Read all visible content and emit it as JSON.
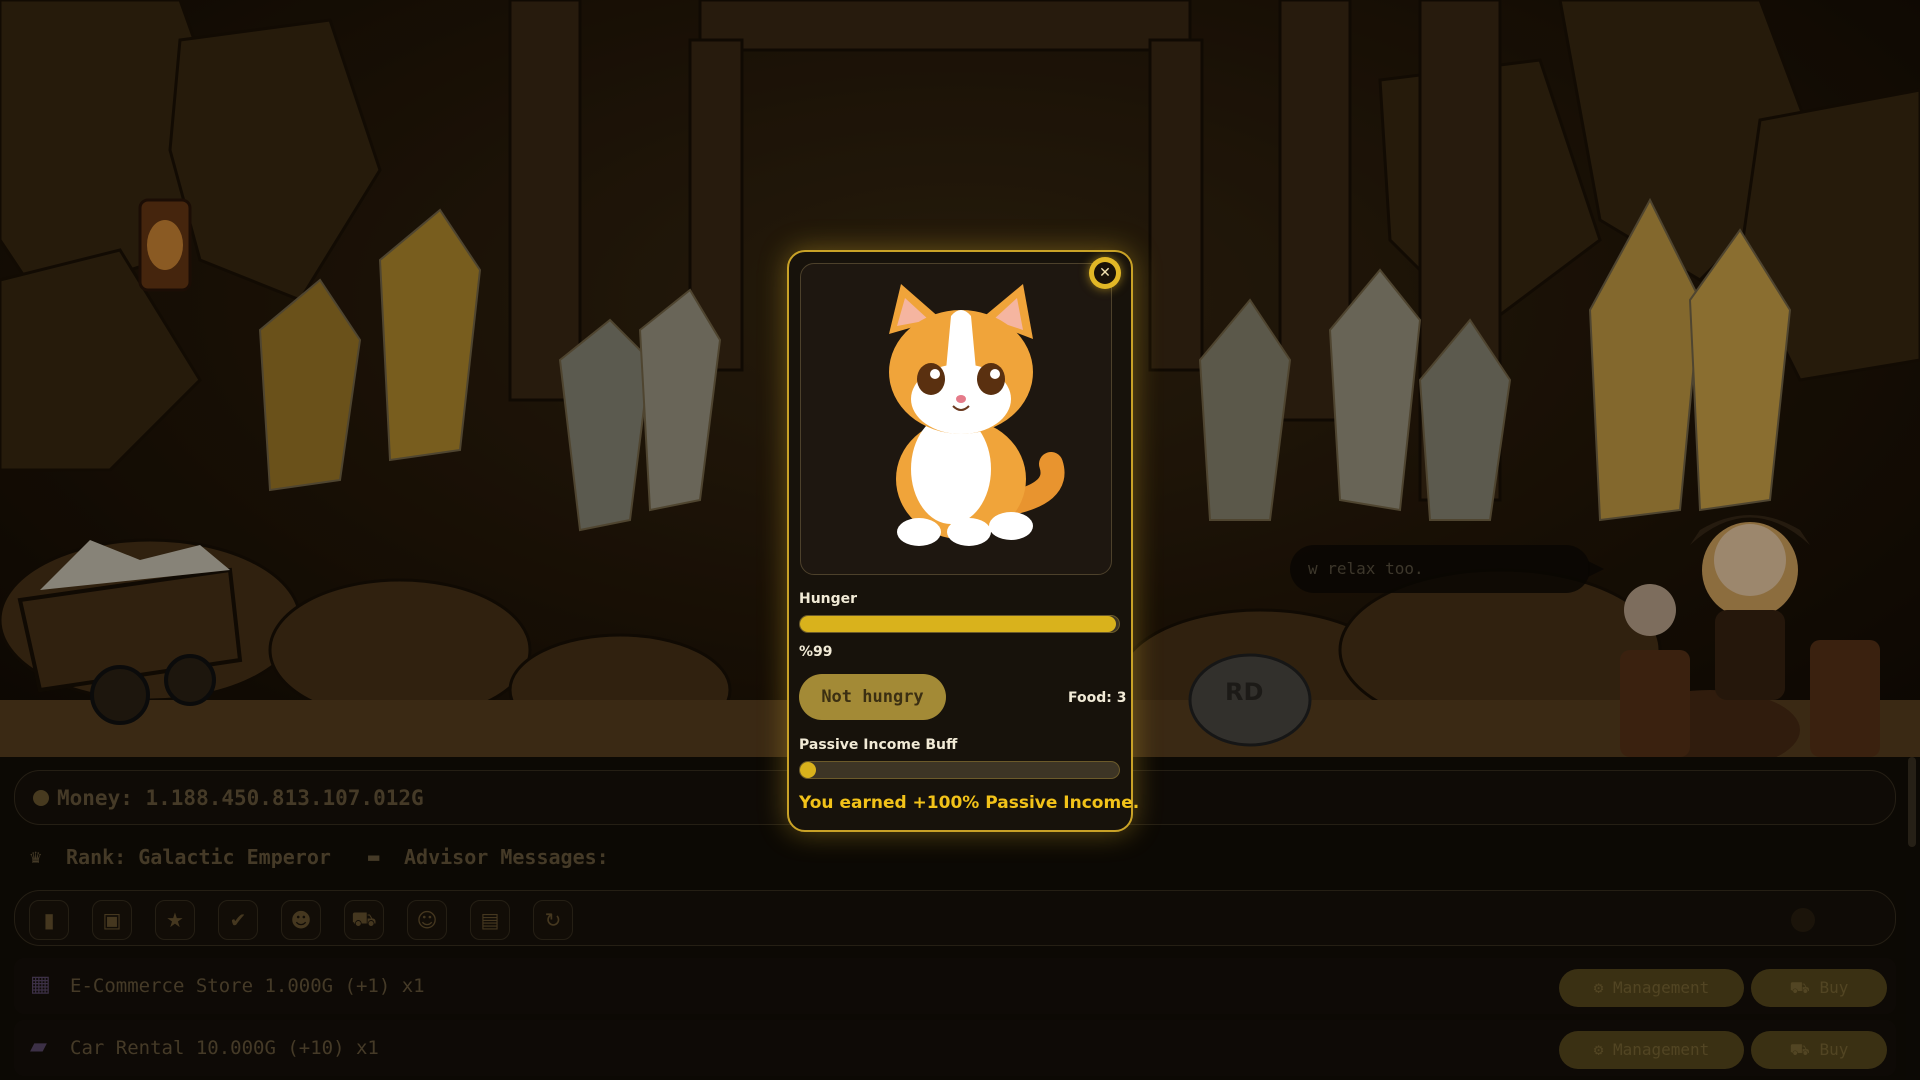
{
  "advisor_bubble": {
    "text": "w relax too."
  },
  "hud": {
    "money_label": "Money: 1.188.450.813.107.012G",
    "rank_label": "Rank: Galactic Emperor",
    "advisor_label": "Advisor Messages:"
  },
  "toolbar": {
    "icons": [
      {
        "name": "document-icon",
        "glyph": "▮"
      },
      {
        "name": "gift-icon",
        "glyph": "▣"
      },
      {
        "name": "star-icon",
        "glyph": "★"
      },
      {
        "name": "checkbox-icon",
        "glyph": "✔"
      },
      {
        "name": "cat-icon",
        "glyph": "☻"
      },
      {
        "name": "cart-icon",
        "glyph": "⛟"
      },
      {
        "name": "advisor-icon",
        "glyph": "☺"
      },
      {
        "name": "chart-icon",
        "glyph": "▤"
      },
      {
        "name": "refresh-icon",
        "glyph": "↻"
      }
    ]
  },
  "businesses": [
    {
      "icon": "store-icon",
      "glyph": "▦",
      "label": "E-Commerce Store 1.000G (+1) x1",
      "management": "Management",
      "buy": "Buy"
    },
    {
      "icon": "car-icon",
      "glyph": "▰",
      "label": "Car Rental 10.000G (+10) x1",
      "management": "Management",
      "buy": "Buy"
    }
  ],
  "pet_modal": {
    "close_glyph": "✕",
    "hunger_label": "Hunger",
    "hunger_value": 0.99,
    "hunger_text": "%99",
    "feed_button": "Not hungry",
    "food_text": "Food: 3",
    "buff_label": "Passive Income Buff",
    "buff_value": 0.02,
    "earned_text": "You earned +100% Passive Income."
  },
  "colors": {
    "accent": "#d9b21c",
    "modal_border": "#c9a227",
    "earned_text": "#f2c219"
  }
}
